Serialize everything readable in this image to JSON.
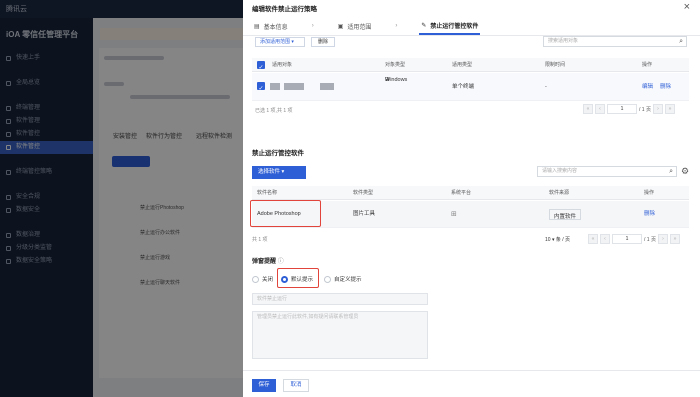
{
  "background": {
    "app_name": "腾讯云",
    "console_label": "iOA 零信任管理平台",
    "page_title": "软件管控",
    "menu": [
      {
        "label": "快速上手",
        "active": false
      },
      {
        "label": "全局总览",
        "active": false
      },
      {
        "label": "终端管理",
        "active": false
      },
      {
        "label": "软件管理",
        "active": false
      },
      {
        "label": "软件管控",
        "active": true
      },
      {
        "label": "终端管控策略",
        "active": false
      },
      {
        "label": "安全合规",
        "active": false
      },
      {
        "label": "数据安全",
        "active": false
      },
      {
        "label": "数据治理",
        "active": false
      },
      {
        "label": "分级分类监管",
        "active": false
      },
      {
        "label": "数据安全策略",
        "active": false
      }
    ],
    "tabs": [
      "安装管控",
      "软件行为管控",
      "远程软件检测"
    ],
    "rows": [
      "禁止运行Photoshop",
      "禁止运行办公软件",
      "禁止运行游戏",
      "禁止运行聊天软件"
    ]
  },
  "drawer": {
    "title": "编辑软件禁止运行策略",
    "close_icon": "close-icon",
    "steps": [
      {
        "label": "基本信息",
        "active": false
      },
      {
        "label": "适用范围",
        "active": false
      },
      {
        "label": "禁止运行管控软件",
        "active": true
      }
    ],
    "scope": {
      "add_scope_button": "添加适用范围",
      "delete_button": "删除",
      "search_placeholder": "搜索适用对象",
      "columns": [
        "适用对象",
        "对象类型",
        "适用类型",
        "限制时间",
        "操作"
      ],
      "rows": [
        {
          "object_type": "Windows",
          "apply_type": "单个终端",
          "time": "-",
          "actions": [
            "编辑",
            "删除"
          ]
        }
      ],
      "selected_count": "已选 1 项,共 1 项",
      "page_input": "1",
      "page_total": "/ 1 页"
    },
    "software": {
      "section_title": "禁止运行管控软件",
      "select_button": "选择软件",
      "search_placeholder": "请输入搜索内容",
      "columns": [
        "软件名称",
        "软件类型",
        "系统平台",
        "软件来源",
        "操作"
      ],
      "rows": [
        {
          "name": "Adobe Photoshop",
          "type": "图片工具",
          "source": "内置软件",
          "action": "删除"
        }
      ],
      "total": "共 1 项",
      "page_size": "10 ▾ 条 / 页",
      "page_input": "1",
      "page_total": "/ 1 页"
    },
    "popup": {
      "label": "弹窗提醒",
      "options": [
        {
          "label": "关闭",
          "selected": false
        },
        {
          "label": "默认提示",
          "selected": true
        },
        {
          "label": "自定义提示",
          "selected": false
        }
      ],
      "title_placeholder": "软件禁止运行",
      "content_placeholder": "管理员禁止运行此软件,如有疑问请联系管理员"
    },
    "footer": {
      "save": "保存",
      "cancel": "取消"
    }
  },
  "colors": {
    "primary": "#2f5fd6",
    "highlight": "#e0443a"
  }
}
